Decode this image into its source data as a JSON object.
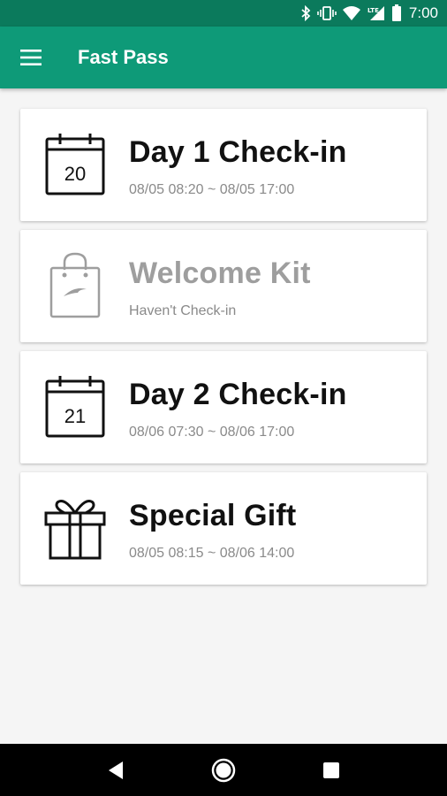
{
  "status": {
    "time": "7:00",
    "network": "LTE"
  },
  "app_bar": {
    "title": "Fast Pass"
  },
  "cards": [
    {
      "title": "Day 1 Check-in",
      "subtitle": "08/05 08:20 ~ 08/05 17:00",
      "icon": "calendar-icon",
      "icon_text": "20",
      "state": "enabled"
    },
    {
      "title": "Welcome Kit",
      "subtitle": "Haven't Check-in",
      "icon": "shopping-bag-icon",
      "state": "disabled"
    },
    {
      "title": "Day 2 Check-in",
      "subtitle": "08/06 07:30 ~ 08/06 17:00",
      "icon": "calendar-icon",
      "icon_text": "21",
      "state": "enabled"
    },
    {
      "title": "Special Gift",
      "subtitle": "08/05 08:15 ~ 08/06 14:00",
      "icon": "gift-icon",
      "state": "enabled"
    }
  ]
}
